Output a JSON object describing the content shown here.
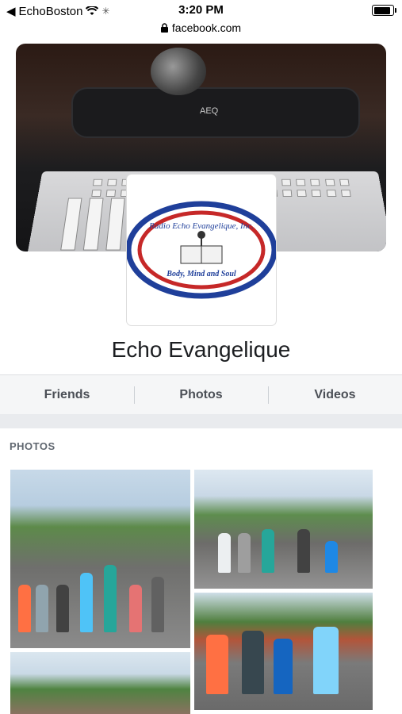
{
  "status": {
    "carrier": "EchoBoston",
    "time": "3:20 PM"
  },
  "browser": {
    "url": "facebook.com"
  },
  "page": {
    "name": "Echo Evangelique",
    "cover_text": "AEQ",
    "logo": {
      "top_text": "Radio Echo Evangelique, Inc.",
      "bottom_text": "Body, Mind and Soul",
      "ring_color_outer": "#1f3f9a",
      "ring_color_inner": "#c62828"
    }
  },
  "tabs": [
    {
      "label": "Friends"
    },
    {
      "label": "Photos"
    },
    {
      "label": "Videos"
    }
  ],
  "photos_section": {
    "title": "PHOTOS"
  }
}
